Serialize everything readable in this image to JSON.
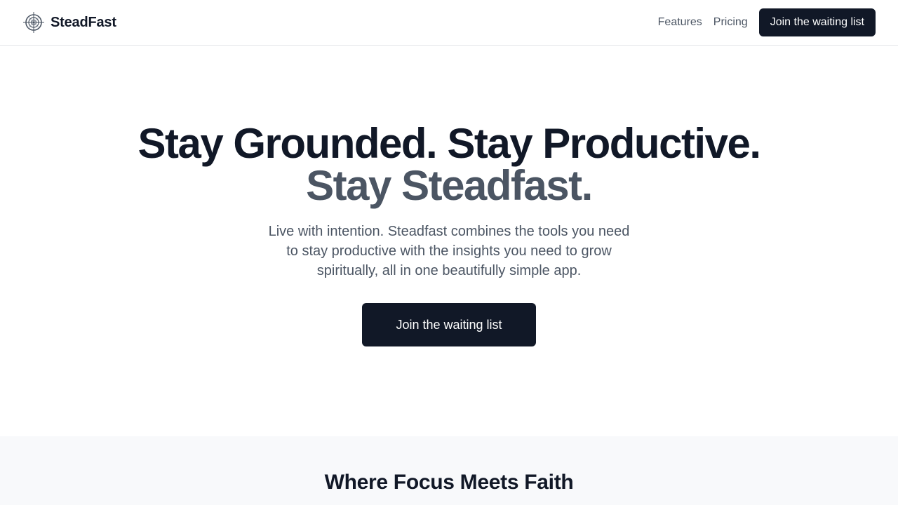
{
  "nav": {
    "brand_name": "SteadFast",
    "logo_icon": "compass-logo-icon",
    "links": [
      {
        "label": "Features"
      },
      {
        "label": "Pricing"
      }
    ],
    "cta_label": "Join the waiting list"
  },
  "hero": {
    "title_line1": "Stay Grounded. Stay Productive.",
    "title_line2": "Stay Steadfast.",
    "subtitle": "Live with intention. Steadfast combines the tools you need to stay productive with the insights you need to grow spiritually, all in one beautifully simple app.",
    "cta_label": "Join the waiting list"
  },
  "features": {
    "title": "Where Focus Meets Faith"
  },
  "colors": {
    "primary": "#111827",
    "muted_text": "#4b5563",
    "border": "#e5e7eb",
    "section_bg": "#f8f9fb"
  }
}
